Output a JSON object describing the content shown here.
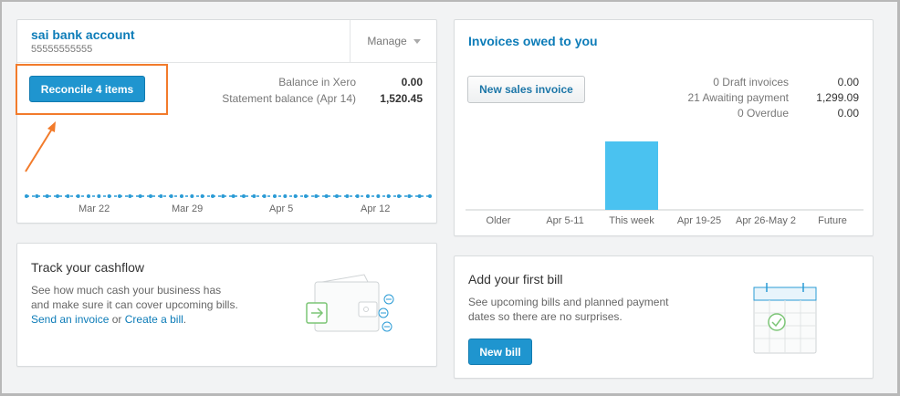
{
  "bank": {
    "title": "sai bank account",
    "account_number": "55555555555",
    "manage_label": "Manage",
    "reconcile_label": "Reconcile 4 items",
    "balance_xero_label": "Balance in Xero",
    "balance_xero_value": "0.00",
    "statement_label": "Statement balance (Apr 14)",
    "statement_value": "1,520.45",
    "axis_labels": [
      "Mar 22",
      "Mar 29",
      "Apr 5",
      "Apr 12"
    ]
  },
  "invoices": {
    "title": "Invoices owed to you",
    "new_invoice_label": "New sales invoice",
    "stats": [
      {
        "label": "0 Draft invoices",
        "value": "0.00"
      },
      {
        "label": "21 Awaiting payment",
        "value": "1,299.09"
      },
      {
        "label": "0 Overdue",
        "value": "0.00"
      }
    ],
    "axis_labels": [
      "Older",
      "Apr 5-11",
      "This week",
      "Apr 19-25",
      "Apr 26-May 2",
      "Future"
    ]
  },
  "chart_data": {
    "type": "bar",
    "categories": [
      "Older",
      "Apr 5-11",
      "This week",
      "Apr 19-25",
      "Apr 26-May 2",
      "Future"
    ],
    "values": [
      0,
      0,
      1299.09,
      0,
      0,
      0
    ],
    "title": "",
    "xlabel": "",
    "ylabel": "",
    "grid": false,
    "colors": {
      "bar": "#4ac2f0"
    }
  },
  "cashflow": {
    "title": "Track your cashflow",
    "line1": "See how much cash your business has",
    "line2": "and make sure it can cover upcoming bills.",
    "send_invoice_link": "Send an invoice",
    "or_text": "or",
    "create_bill_link": "Create a bill",
    "period": "."
  },
  "bill": {
    "title": "Add your first bill",
    "line1": "See upcoming bills and planned payment",
    "line2": "dates so there are no surprises.",
    "new_bill_label": "New bill"
  },
  "colors": {
    "accent": "#1f95cf",
    "link": "#0d7cb8",
    "annotation": "#f27b2b",
    "bar": "#4ac2f0"
  }
}
